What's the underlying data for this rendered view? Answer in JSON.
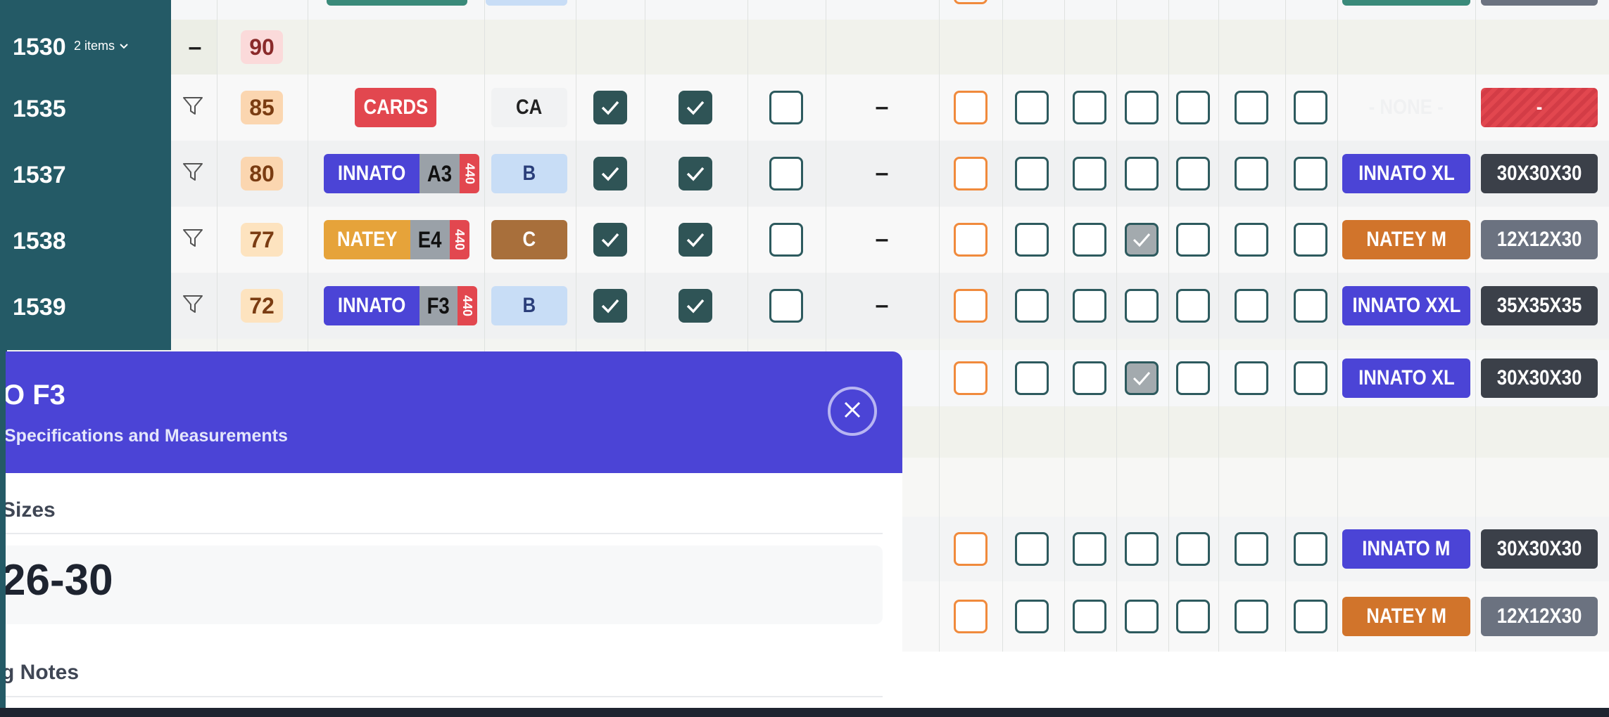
{
  "colors": {
    "teal": "#245a66",
    "indigo": "#4b44d6",
    "orange": "#e6a33a",
    "brown": "#a86f3b",
    "gray_box": "#5e6570",
    "dark_box": "#3b4049",
    "red": "#e2474f"
  },
  "rows": [
    {
      "id": "1530",
      "items_label": "2 items",
      "priority": "90"
    },
    {
      "id": "1535",
      "priority": "85",
      "product": "CARDS",
      "type": "CA",
      "cb1": true,
      "cb2": true,
      "cb3": false,
      "dash": "–",
      "size_label": "- NONE -",
      "box_label": "-"
    },
    {
      "id": "1537",
      "priority": "80",
      "product": "INNATO",
      "code": "A3",
      "num": "440",
      "type": "B",
      "cb1": true,
      "cb2": true,
      "cb3": false,
      "dash": "–",
      "size_label": "INNATO XL",
      "box_label": "30X30X30"
    },
    {
      "id": "1538",
      "priority": "77",
      "product": "NATEY",
      "code": "E4",
      "num": "440",
      "type": "C",
      "cb1": true,
      "cb2": true,
      "cb3": false,
      "dash": "–",
      "size_label": "NATEY M",
      "box_label": "12X12X30"
    },
    {
      "id": "1539",
      "priority": "72",
      "product": "INNATO",
      "code": "F3",
      "num": "440",
      "type": "B",
      "cb1": true,
      "cb2": true,
      "cb3": false,
      "dash": "–",
      "size_label": "INNATO XXL",
      "box_label": "35X35X35"
    }
  ],
  "lower_rows": [
    {
      "size_label": "INNATO XL",
      "box_label": "30X30X30"
    },
    {
      "size_label": "INNATO M",
      "box_label": "30X30X30"
    },
    {
      "size_label": "NATEY M",
      "box_label": "12X12X30"
    }
  ],
  "modal": {
    "title": "O F3",
    "subtitle": "Specifications and Measurements",
    "sizes_heading": "Sizes",
    "sizes_value": "26-30",
    "notes_heading": "g Notes"
  }
}
